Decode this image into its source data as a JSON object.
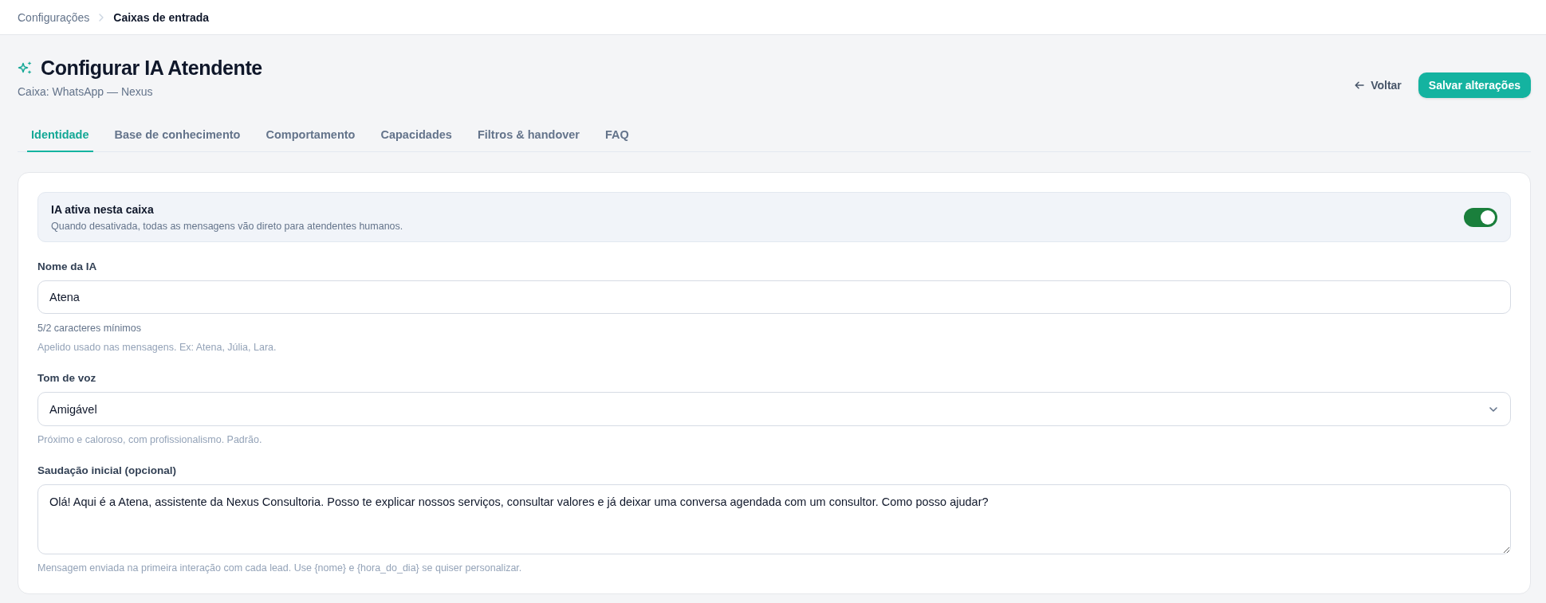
{
  "breadcrumb": [
    {
      "label": "Configurações",
      "current": false
    },
    {
      "label": "Caixas de entrada",
      "current": true
    }
  ],
  "header": {
    "title": "Configurar IA Atendente",
    "subtitle": "Caixa: WhatsApp — Nexus"
  },
  "actions": {
    "back": "Voltar",
    "save": "Salvar alterações"
  },
  "tabs": [
    {
      "label": "Identidade",
      "selected": true
    },
    {
      "label": "Base de conhecimento",
      "selected": false
    },
    {
      "label": "Comportamento",
      "selected": false
    },
    {
      "label": "Capacidades",
      "selected": false
    },
    {
      "label": "Filtros & handover",
      "selected": false
    },
    {
      "label": "FAQ",
      "selected": false
    }
  ],
  "ai_toggle": {
    "title": "IA ativa nesta caixa",
    "description": "Quando desativada, todas as mensagens vão direto para atendentes humanos.",
    "on": true
  },
  "fields": [
    {
      "kind": "text",
      "label": "Nome da IA",
      "value": "Atena",
      "counter": "5/2 caracteres mínimos",
      "hint": "Apelido usado nas mensagens. Ex: Atena, Júlia, Lara."
    },
    {
      "kind": "select",
      "label": "Tom de voz",
      "value": "Amigável",
      "hint": "Próximo e caloroso, com profissionalismo. Padrão."
    },
    {
      "kind": "textarea",
      "label": "Saudação inicial (opcional)",
      "value": "Olá! Aqui é a Atena, assistente da Nexus Consultoria. Posso te explicar nossos serviços, consultar valores e já deixar uma conversa agendada com um consultor. Como posso ajudar?",
      "hint": "Mensagem enviada na primeira interação com cada lead. Use {nome} e {hora_do_dia} se quiser personalizar."
    }
  ]
}
